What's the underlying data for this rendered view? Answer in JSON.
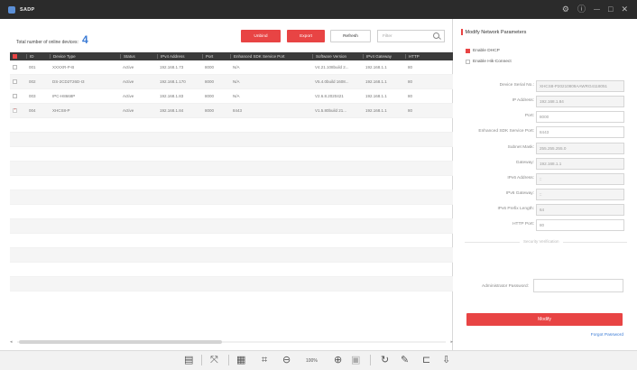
{
  "app": {
    "title": "SADP"
  },
  "window_controls": {
    "settings": "⚙",
    "info": "ⓘ",
    "minimize": "—",
    "restore": "□",
    "close": "✕"
  },
  "stats": {
    "label": "Total number of online devices:",
    "count": "4"
  },
  "toolbar_actions": {
    "unbind": "Unbind",
    "export": "Export",
    "refresh": "Refresh"
  },
  "search": {
    "placeholder": "Filter"
  },
  "table": {
    "headers": [
      "ID",
      "Device Type",
      "Status",
      "IPv4 Address",
      "Port",
      "Enhanced SDK Service Port",
      "Software Version",
      "IPv4 Gateway",
      "HTTP"
    ],
    "rows": [
      {
        "checked": false,
        "id": "001",
        "type": "XXXXR-P-B",
        "status": "Active",
        "ipv4": "192.168.1.73",
        "port": "8000",
        "sdk": "N/A",
        "sw": "V4.21.108build 2...",
        "gw": "192.168.1.1",
        "http": "80"
      },
      {
        "checked": false,
        "id": "002",
        "type": "DS-2CD2T26D-I3",
        "status": "Active",
        "ipv4": "192.168.1.170",
        "port": "8000",
        "sdk": "N/A",
        "sw": "V5.4.0build 1608...",
        "gw": "192.168.1.1",
        "http": "80"
      },
      {
        "checked": false,
        "id": "003",
        "type": "IPC-H8668P",
        "status": "Active",
        "ipv4": "192.168.1.83",
        "port": "8000",
        "sdk": "N/A",
        "sw": "V2.6.8.2020421",
        "gw": "192.168.1.1",
        "http": "80"
      },
      {
        "checked": true,
        "id": "004",
        "type": "XHCS8-P",
        "status": "Active",
        "ipv4": "192.168.1.84",
        "port": "8000",
        "sdk": "8443",
        "sw": "V1.5.80build 21...",
        "gw": "192.168.1.1",
        "http": "80"
      }
    ]
  },
  "panel": {
    "title": "Modify Network Parameters",
    "enable_dhcp": "Enable DHCP",
    "enable_hik_connect": "Enable Hik-Connect",
    "fields": [
      {
        "label": "Device Serial No.:",
        "value": "XHCS8-P20210809AAWRG4118051"
      },
      {
        "label": "IP Address:",
        "value": "192.168.1.84"
      },
      {
        "label": "Port:",
        "value": "8000"
      },
      {
        "label": "Enhanced SDK Service Port:",
        "value": "8443"
      },
      {
        "label": "Subnet Mask:",
        "value": "255.255.255.0"
      },
      {
        "label": "Gateway:",
        "value": "192.168.1.1"
      },
      {
        "label": "IPv6 Address:",
        "value": "::"
      },
      {
        "label": "IPv6 Gateway:",
        "value": "::"
      },
      {
        "label": "IPv6 Prefix Length:",
        "value": "64"
      },
      {
        "label": "HTTP Port:",
        "value": "80"
      }
    ],
    "security_divider": "Security Verification",
    "admin_password_label": "Administrator Password:",
    "modify_button": "Modify",
    "forgot_password": "Forgot Password"
  },
  "bottom_toolbar": {
    "zoom_level": "100%",
    "icons": [
      "layout-icon",
      "fit-icon",
      "image-icon",
      "crop-icon",
      "zoom-out-icon",
      "zoom-in-icon",
      "page-icon",
      "rotate-icon",
      "edit-icon",
      "crop-tool-icon",
      "share-icon"
    ]
  }
}
